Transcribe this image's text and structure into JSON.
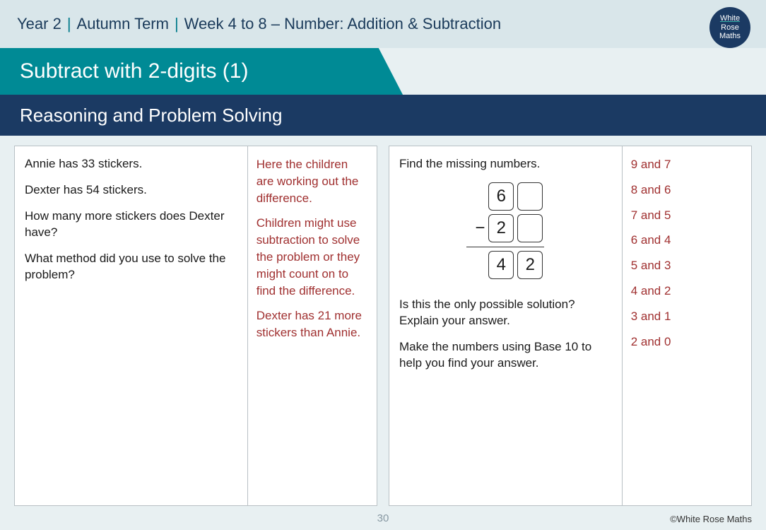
{
  "header": {
    "year": "Year 2",
    "term": "Autumn Term",
    "unit": "Week 4 to 8 – Number: Addition & Subtraction",
    "logo": [
      "White",
      "Rose",
      "Maths"
    ]
  },
  "title": "Subtract with 2-digits (1)",
  "subtitle": "Reasoning and Problem Solving",
  "panel1": {
    "q": [
      "Annie has 33 stickers.",
      "Dexter has 54 stickers.",
      "How many more stickers does Dexter have?",
      "What method did you use to solve the problem?"
    ],
    "a": [
      "Here the children are working out the difference.",
      "Children might use subtraction to solve the problem or they might count on to find the difference.",
      "Dexter has 21 more stickers than Annie."
    ]
  },
  "panel2": {
    "q_intro": "Find the missing numbers.",
    "figure": {
      "row1": [
        "6",
        ""
      ],
      "op": "−",
      "row2": [
        "2",
        ""
      ],
      "result": [
        "4",
        "2"
      ]
    },
    "q_after": [
      "Is this the only possible solution? Explain your answer.",
      "Make the numbers using Base 10 to help you find your answer."
    ],
    "a": [
      "9 and 7",
      "8 and 6",
      "7 and 5",
      "6 and 4",
      "5 and 3",
      "4 and 2",
      "3 and 1",
      "2 and 0"
    ]
  },
  "page_num": "30",
  "copyright": "©White Rose Maths"
}
